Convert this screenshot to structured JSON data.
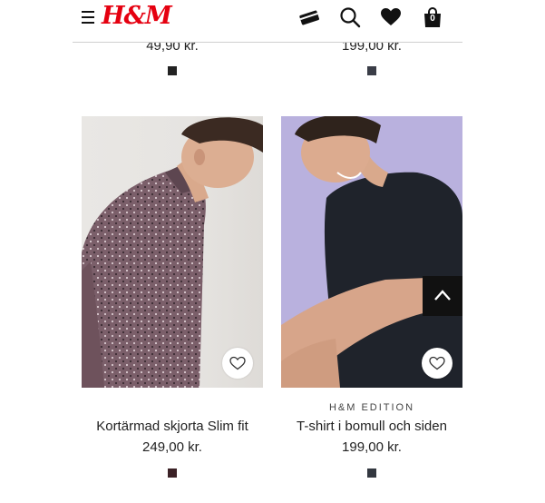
{
  "header": {
    "logo_text": "H&M",
    "icons": [
      "menu-icon",
      "credit-card-icon",
      "search-icon",
      "heart-icon",
      "shopping-bag-icon"
    ],
    "bag_count": "0",
    "brand_color": "#e50010"
  },
  "top_row": [
    {
      "price": "49,90 kr.",
      "swatch_color": "#222222"
    },
    {
      "price": "199,00 kr.",
      "swatch_color": "#3a3d47"
    }
  ],
  "products": [
    {
      "label": "",
      "name": "Kortärmad skjorta Slim fit",
      "price": "249,00 kr.",
      "swatch_color": "#3b2126"
    },
    {
      "label": "H&M EDITION",
      "name": "T-shirt i bomull och siden",
      "price": "199,00 kr.",
      "swatch_color": "#333840"
    }
  ]
}
